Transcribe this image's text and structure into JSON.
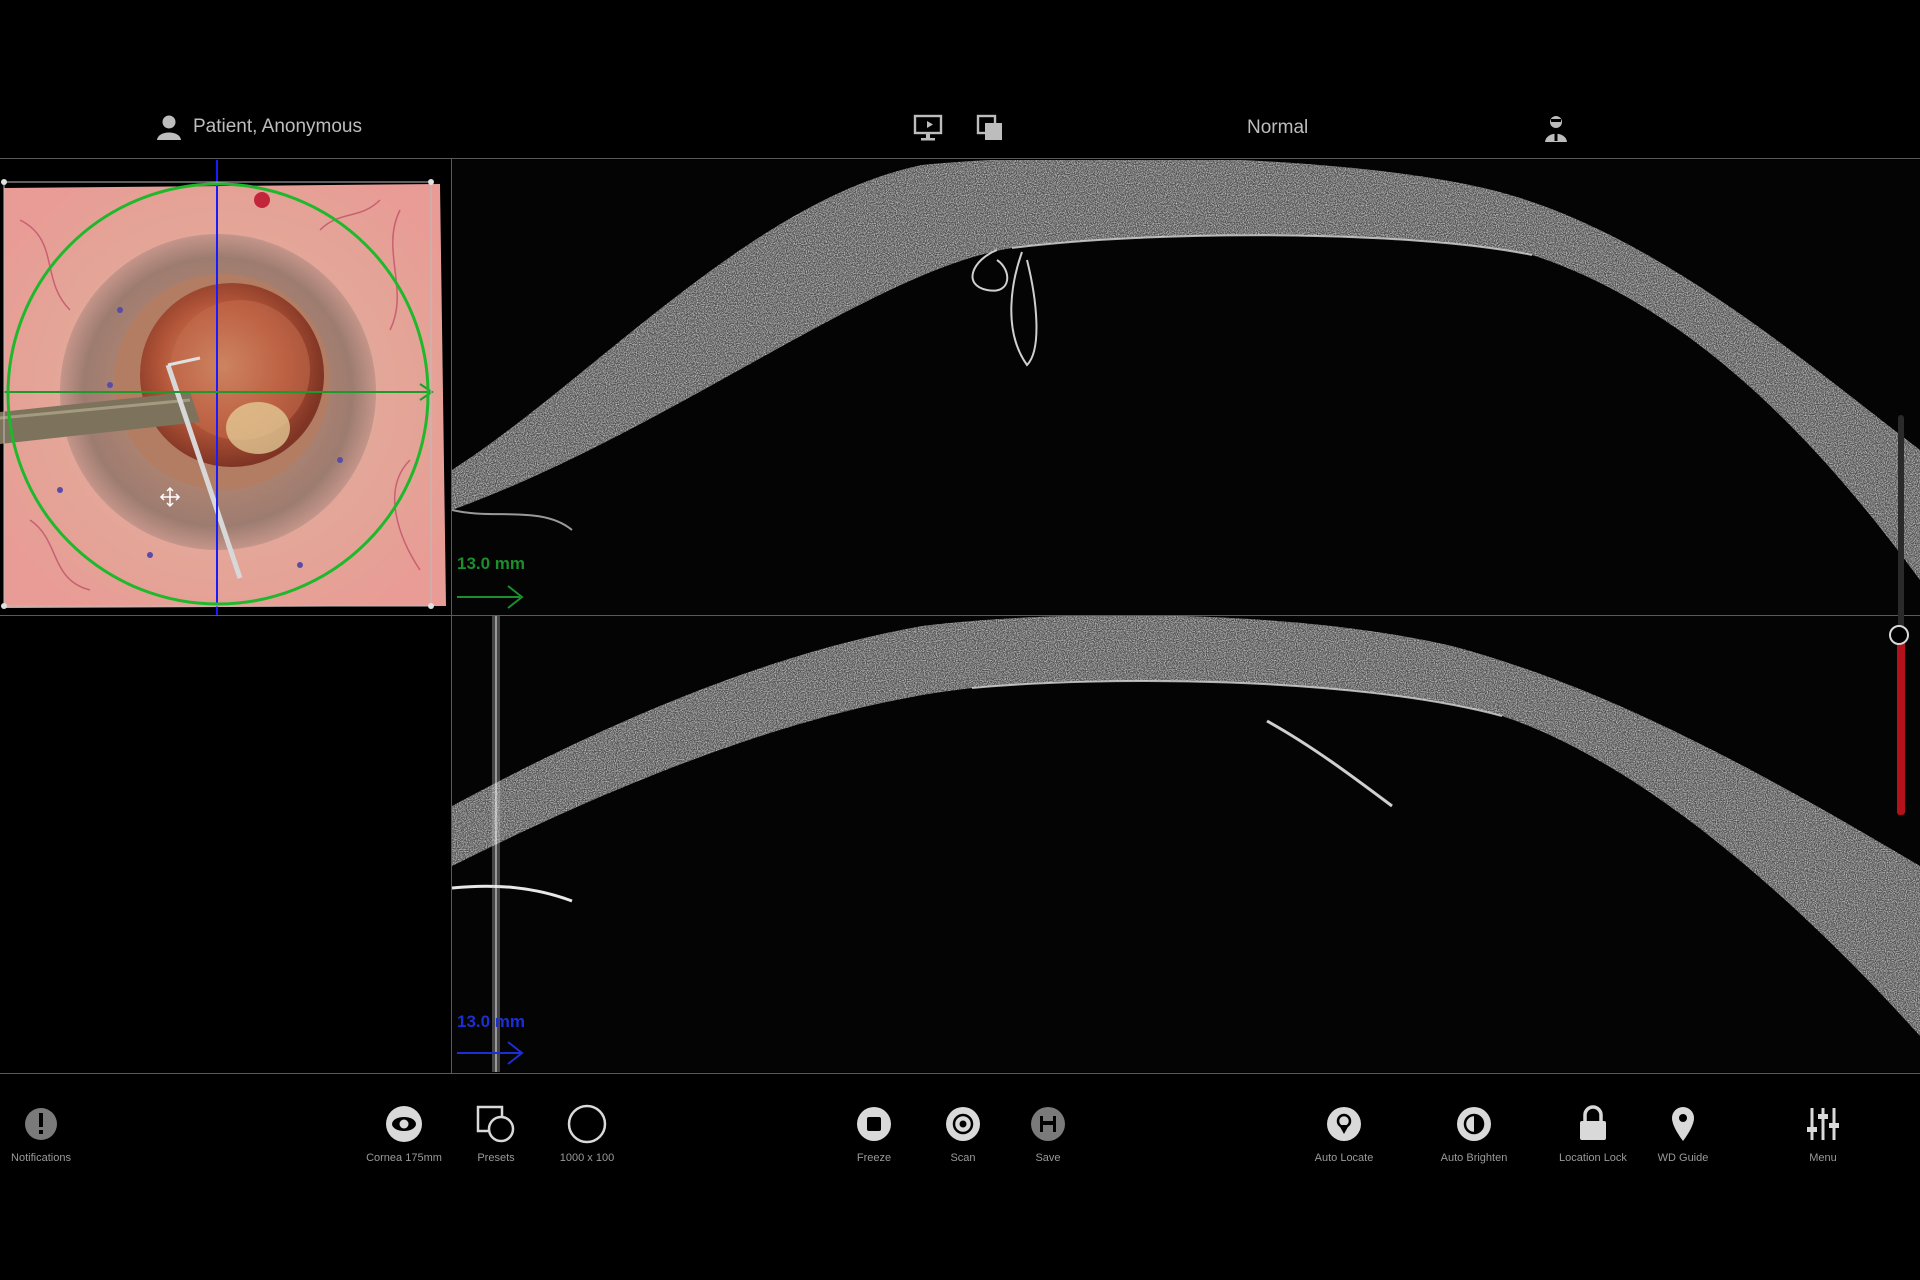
{
  "header": {
    "patient_name": "Patient, Anonymous",
    "mode": "Normal",
    "icons": [
      "user-icon",
      "display-icon",
      "window-icon",
      "surgeon-icon"
    ]
  },
  "scans": {
    "top_scale": "13.0 mm",
    "bottom_scale": "13.0 mm",
    "top_scale_color": "#1a8f2b",
    "bottom_scale_color": "#1c2fd6"
  },
  "toolbar": {
    "notifications": "Notifications",
    "cornea": "Cornea 175mm",
    "presets": "Presets",
    "resolution": "1000 x 100",
    "freeze": "Freeze",
    "scan": "Scan",
    "save": "Save",
    "auto_locate": "Auto Locate",
    "auto_brighten": "Auto Brighten",
    "location_lock": "Location Lock",
    "wd_guide": "WD Guide",
    "menu": "Menu"
  },
  "colors": {
    "accent_green": "#1fb82c",
    "accent_blue": "#1a1aff",
    "slider_red": "#b3121b"
  },
  "slider": {
    "level": 0.44
  }
}
